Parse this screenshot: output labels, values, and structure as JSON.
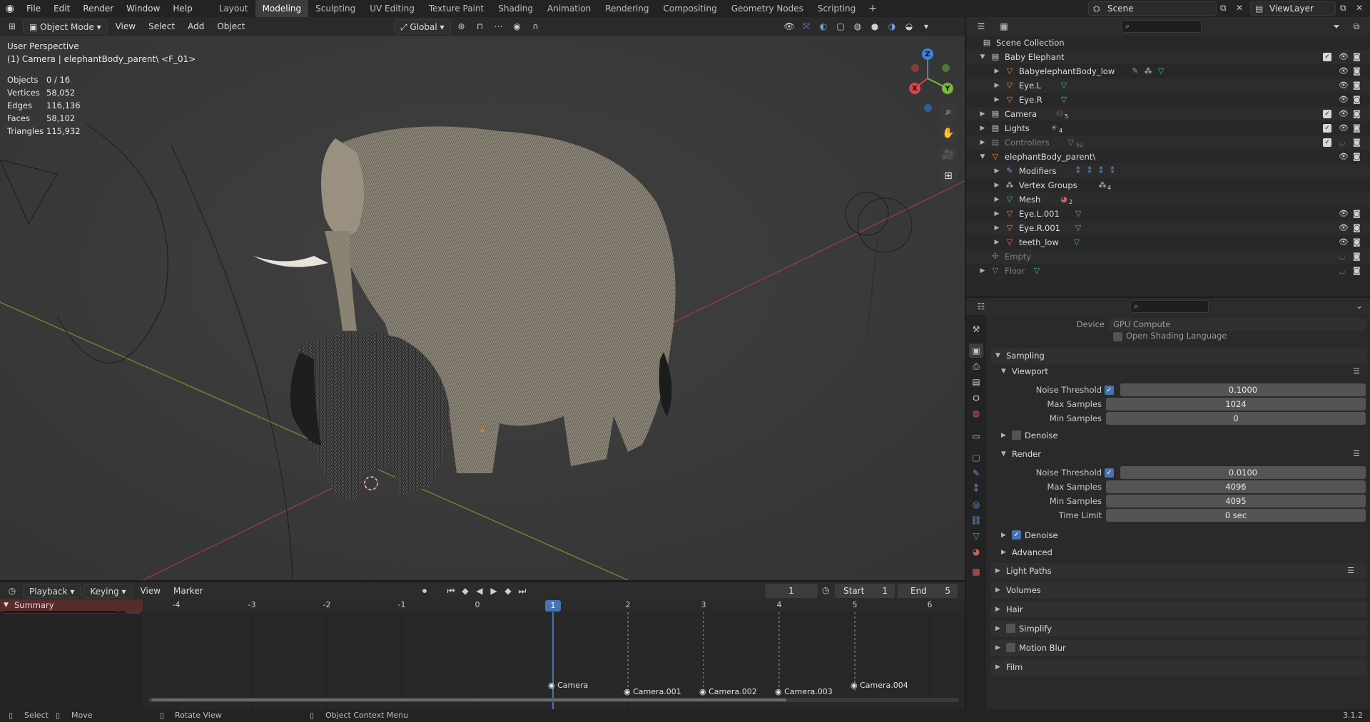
{
  "topbar": {
    "menus": [
      "File",
      "Edit",
      "Render",
      "Window",
      "Help"
    ],
    "workspaces": [
      "Layout",
      "Modeling",
      "Sculpting",
      "UV Editing",
      "Texture Paint",
      "Shading",
      "Animation",
      "Rendering",
      "Compositing",
      "Geometry Nodes",
      "Scripting"
    ],
    "active_workspace": "Modeling",
    "add_workspace": "+",
    "scene": "Scene",
    "view_layer": "ViewLayer"
  },
  "viewport": {
    "mode": "Object Mode",
    "menus": [
      "View",
      "Select",
      "Add",
      "Object"
    ],
    "transform_orientation": "Global",
    "perspective": "User Perspective",
    "active_object": "(1) Camera | elephantBody_parent\\ <F_01>",
    "stats": [
      {
        "label": "Objects",
        "value": "0 / 16"
      },
      {
        "label": "Vertices",
        "value": "58,052"
      },
      {
        "label": "Edges",
        "value": "116,136"
      },
      {
        "label": "Faces",
        "value": "58,102"
      },
      {
        "label": "Triangles",
        "value": "115,932"
      }
    ],
    "gizmo": {
      "x": "X",
      "y": "Y",
      "z": "Z"
    },
    "colors": {
      "x_axis": "#e0424e",
      "y_axis": "#7bb83a",
      "z_axis": "#3e83d6"
    }
  },
  "timeline": {
    "menus": [
      "Playback",
      "Keying",
      "View",
      "Marker"
    ],
    "current_frame": "1",
    "start_label": "Start",
    "start": "1",
    "end_label": "End",
    "end": "5",
    "ticks": [
      "-4",
      "-3",
      "-2",
      "-1",
      "0",
      "1",
      "2",
      "3",
      "4",
      "5",
      "6"
    ],
    "summary": "Summary",
    "markers": [
      "Camera",
      "Camera.001",
      "Camera.002",
      "Camera.003",
      "Camera.004"
    ]
  },
  "status": {
    "select": "Select",
    "move": "Move",
    "rotate": "Rotate View",
    "context": "Object Context Menu",
    "version": "3.1.2"
  },
  "outliner": {
    "rows": [
      {
        "label": "Scene Collection"
      },
      {
        "label": "Baby Elephant"
      },
      {
        "label": "BabyelephantBody_low"
      },
      {
        "label": "Eye.L"
      },
      {
        "label": "Eye.R"
      },
      {
        "label": "Camera",
        "badge": "5"
      },
      {
        "label": "Lights",
        "badge": "4"
      },
      {
        "label": "Controllers",
        "badge": "52"
      },
      {
        "label": "elephantBody_parent\\"
      },
      {
        "label": "Modifiers"
      },
      {
        "label": "Vertex Groups",
        "badge": "4"
      },
      {
        "label": "Mesh",
        "badge": "2"
      },
      {
        "label": "Eye.L.001"
      },
      {
        "label": "Eye.R.001"
      },
      {
        "label": "teeth_low"
      },
      {
        "label": "Empty"
      },
      {
        "label": "Floor"
      }
    ]
  },
  "properties": {
    "device_label": "Device",
    "device": "GPU Compute",
    "osl": "Open Shading Language",
    "sampling": "Sampling",
    "viewport": "Viewport",
    "render": "Render",
    "noise_threshold_label": "Noise Threshold",
    "max_samples_label": "Max Samples",
    "min_samples_label": "Min Samples",
    "time_limit_label": "Time Limit",
    "denoise": "Denoise",
    "advanced": "Advanced",
    "vp_noise_threshold": "0.1000",
    "vp_max_samples": "1024",
    "vp_min_samples": "0",
    "r_noise_threshold": "0.0100",
    "r_max_samples": "4096",
    "r_min_samples": "4095",
    "r_time_limit": "0 sec",
    "sections": [
      "Light Paths",
      "Volumes",
      "Hair",
      "Simplify",
      "Motion Blur",
      "Film"
    ]
  }
}
